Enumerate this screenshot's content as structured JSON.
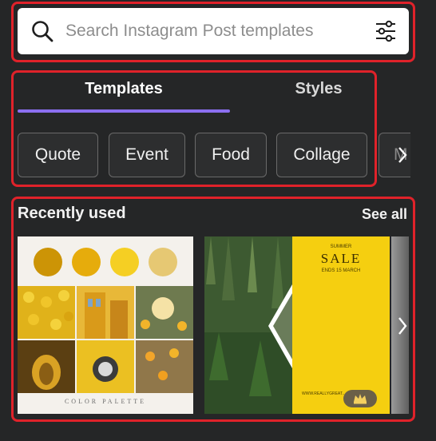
{
  "search": {
    "placeholder": "Search Instagram Post templates",
    "search_icon": "search-icon",
    "filter_icon": "sliders-icon"
  },
  "tabs": [
    {
      "label": "Templates",
      "active": true
    },
    {
      "label": "Styles",
      "active": false
    }
  ],
  "chips": [
    "Quote",
    "Event",
    "Food",
    "Collage",
    "M"
  ],
  "recently_used": {
    "title": "Recently used",
    "see_all": "See all",
    "cards": [
      {
        "caption": "COLOR PALETTE",
        "swatches": [
          "#cc9406",
          "#e6ac0c",
          "#f5cf23",
          "#e6c873"
        ]
      },
      {
        "eyebrow": "SUMMER",
        "headline": "SALE",
        "subline": "ENDS 15 MARCH",
        "url": "WWW.REALLYGREAT...",
        "badge_icon": "crown-icon"
      }
    ]
  },
  "colors": {
    "background": "#252627",
    "accent": "#8b6ff0",
    "highlight": "#e0222a",
    "sale_yellow": "#f5cf10"
  }
}
